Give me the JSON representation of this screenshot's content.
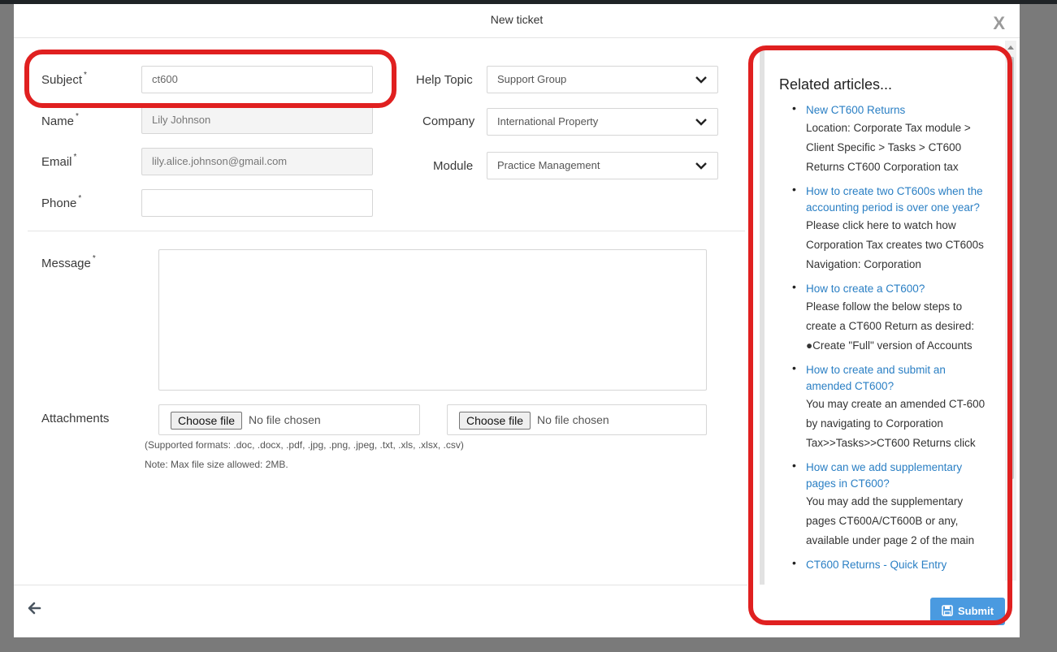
{
  "modal": {
    "title": "New ticket",
    "close_label": "X"
  },
  "form": {
    "subject": {
      "label": "Subject",
      "value": "ct600"
    },
    "name": {
      "label": "Name",
      "value": "Lily Johnson"
    },
    "email": {
      "label": "Email",
      "value": "lily.alice.johnson@gmail.com"
    },
    "phone": {
      "label": "Phone",
      "value": ""
    },
    "help_topic": {
      "label": "Help Topic",
      "value": "Support Group"
    },
    "company": {
      "label": "Company",
      "value": "International Property"
    },
    "module": {
      "label": "Module",
      "value": "Practice Management"
    },
    "message": {
      "label": "Message"
    },
    "required_mark": "*",
    "attachments": {
      "label": "Attachments",
      "button_label": "Choose file",
      "no_file": "No file chosen",
      "formats_note": "(Supported formats: .doc, .docx, .pdf, .jpg, .png, .jpeg, .txt, .xls, .xlsx, .csv)",
      "size_note": "Note: Max file size allowed: 2MB."
    }
  },
  "related": {
    "heading": "Related articles...",
    "articles": [
      {
        "title": "New CT600 Returns",
        "body": "Location: Corporate Tax module > Client Specific > Tasks > CT600 Returns CT600 Corporation tax"
      },
      {
        "title": "How to create two CT600s when the accounting period is over one year?",
        "body": "Please click here to watch how Corporation Tax creates two CT600s Navigation: Corporation"
      },
      {
        "title": "How to create a CT600?",
        "body": "Please follow the below steps to create a CT600 Return as desired: ●Create \"Full\" version of Accounts"
      },
      {
        "title": "How to create and submit an amended CT600?",
        "body": "You may create an amended CT-600 by navigating to Corporation Tax>>Tasks>>CT600 Returns click"
      },
      {
        "title": "How can we add supplementary pages in CT600?",
        "body": "You may add the supplementary pages CT600A/CT600B or any, available under page 2 of the main"
      },
      {
        "title": "CT600 Returns - Quick Entry",
        "body": ""
      }
    ]
  },
  "footer": {
    "submit_label": "Submit"
  },
  "colors": {
    "accent": "#4a9ae0",
    "link": "#2a7fc4",
    "highlight": "#e02020"
  }
}
